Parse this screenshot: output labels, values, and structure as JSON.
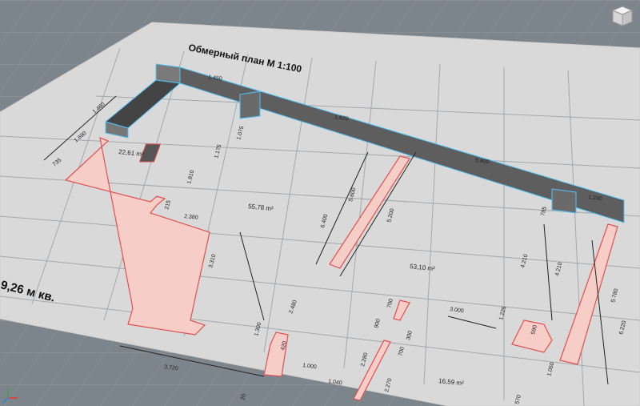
{
  "plan": {
    "title": "Обмерный план  М 1:100",
    "area_left": "9,26 м кв."
  },
  "rooms": [
    {
      "id": "room-a",
      "label": "22,61 m²"
    },
    {
      "id": "room-b",
      "label": "55,78 m²"
    },
    {
      "id": "room-c",
      "label": "53,10 m²"
    },
    {
      "id": "room-d",
      "label": "16,59 m²"
    }
  ],
  "dimensions": [
    "1.460",
    "1.450",
    "1.690",
    "735",
    "1.075",
    "1.175",
    "1.810",
    "1.620",
    "2.380",
    "215",
    "3.310",
    "1.300",
    "3.720",
    "1.000",
    "1.040",
    "2.280",
    "2.270",
    "2.480",
    "6.400",
    "5.600",
    "5.200",
    "5.400",
    "1.240",
    "785",
    "4.210",
    "4.210",
    "5.780",
    "6.220",
    "3.000",
    "1.225",
    "590",
    "1.050",
    "570",
    "700",
    "900",
    "300",
    "700",
    "420",
    "20"
  ],
  "colors": {
    "ground": "#7d858c",
    "sheet": "#d8d8d8",
    "grid": "#9aa0a6",
    "wall_3d": "#5a5a5a",
    "wall_edge": "#4fc3f7",
    "wall_fill": "#f5c6c0",
    "wall_line": "#e05050",
    "ink": "#1a1a1a"
  },
  "icons": [
    "view-cube-icon",
    "axis-gizmo-icon"
  ]
}
